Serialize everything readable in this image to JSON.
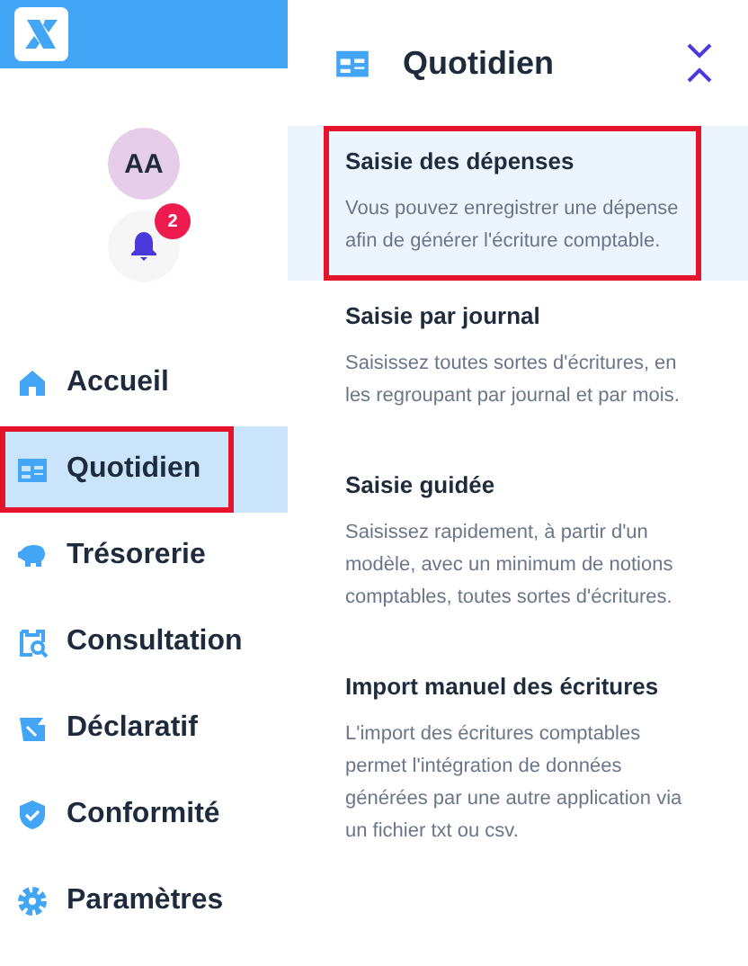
{
  "sidebar": {
    "avatar": "AA",
    "notifications": {
      "count": "2"
    },
    "items": [
      {
        "kind": "home",
        "label": "Accueil",
        "selected": false,
        "highlighted": false
      },
      {
        "kind": "daily",
        "label": "Quotidien",
        "selected": true,
        "highlighted": true
      },
      {
        "kind": "piggy",
        "label": "Trésorerie",
        "selected": false,
        "highlighted": false
      },
      {
        "kind": "search",
        "label": "Consultation",
        "selected": false,
        "highlighted": false
      },
      {
        "kind": "declare",
        "label": "Déclaratif",
        "selected": false,
        "highlighted": false
      },
      {
        "kind": "shield",
        "label": "Conformité",
        "selected": false,
        "highlighted": false
      },
      {
        "kind": "gear",
        "label": "Paramètres",
        "selected": false,
        "highlighted": false
      }
    ]
  },
  "panel": {
    "title": "Quotidien",
    "items": [
      {
        "title": "Saisie des dépenses",
        "description": "Vous pouvez enregistrer une dépense\nafin de générer l'écriture comptable.",
        "selected": true,
        "highlighted": true
      },
      {
        "title": "Saisie par journal",
        "description": "Saisissez toutes sortes d'écritures, en\nles regroupant par journal et par mois.",
        "selected": false,
        "highlighted": false
      },
      {
        "title": "Saisie guidée",
        "description": "Saisissez rapidement, à partir d'un\nmodèle, avec un minimum de notions\ncomptables, toutes sortes d'écritures.",
        "selected": false,
        "highlighted": false
      },
      {
        "title": "Import manuel des écritures",
        "description": "L'import des écritures comptables\npermet l'intégration de données\ngénérées par une autre application via\nun fichier txt ou csv.",
        "selected": false,
        "highlighted": false
      }
    ]
  }
}
